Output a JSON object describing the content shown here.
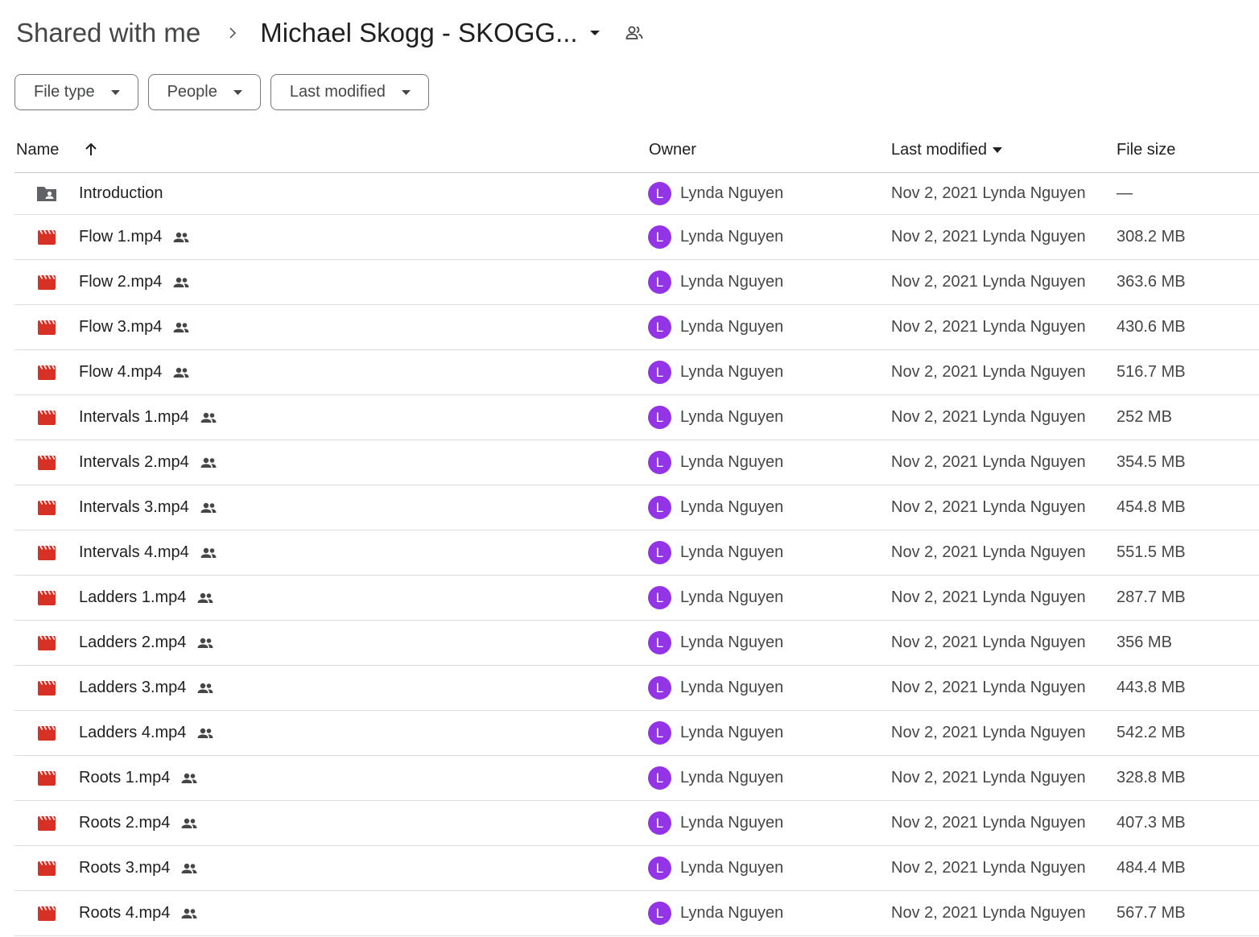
{
  "breadcrumb": {
    "root": "Shared with me",
    "current": "Michael Skogg - SKOGG..."
  },
  "filters": [
    {
      "label": "File type"
    },
    {
      "label": "People"
    },
    {
      "label": "Last modified"
    }
  ],
  "columns": {
    "name": "Name",
    "owner": "Owner",
    "last_modified": "Last modified",
    "file_size": "File size"
  },
  "colors": {
    "avatar": "#9334e6",
    "video_icon": "#d93025",
    "folder_icon": "#5f6368"
  },
  "rows": [
    {
      "type": "folder",
      "icon": "shared-folder-icon",
      "name": "Introduction",
      "shared": false,
      "owner_initial": "L",
      "owner": "Lynda Nguyen",
      "modified": "Nov 2, 2021 Lynda Nguyen",
      "size": "—"
    },
    {
      "type": "video",
      "icon": "video-file-icon",
      "name": "Flow 1.mp4",
      "shared": true,
      "owner_initial": "L",
      "owner": "Lynda Nguyen",
      "modified": "Nov 2, 2021 Lynda Nguyen",
      "size": "308.2 MB"
    },
    {
      "type": "video",
      "icon": "video-file-icon",
      "name": "Flow 2.mp4",
      "shared": true,
      "owner_initial": "L",
      "owner": "Lynda Nguyen",
      "modified": "Nov 2, 2021 Lynda Nguyen",
      "size": "363.6 MB"
    },
    {
      "type": "video",
      "icon": "video-file-icon",
      "name": "Flow 3.mp4",
      "shared": true,
      "owner_initial": "L",
      "owner": "Lynda Nguyen",
      "modified": "Nov 2, 2021 Lynda Nguyen",
      "size": "430.6 MB"
    },
    {
      "type": "video",
      "icon": "video-file-icon",
      "name": "Flow 4.mp4",
      "shared": true,
      "owner_initial": "L",
      "owner": "Lynda Nguyen",
      "modified": "Nov 2, 2021 Lynda Nguyen",
      "size": "516.7 MB"
    },
    {
      "type": "video",
      "icon": "video-file-icon",
      "name": "Intervals 1.mp4",
      "shared": true,
      "owner_initial": "L",
      "owner": "Lynda Nguyen",
      "modified": "Nov 2, 2021 Lynda Nguyen",
      "size": "252 MB"
    },
    {
      "type": "video",
      "icon": "video-file-icon",
      "name": "Intervals 2.mp4",
      "shared": true,
      "owner_initial": "L",
      "owner": "Lynda Nguyen",
      "modified": "Nov 2, 2021 Lynda Nguyen",
      "size": "354.5 MB"
    },
    {
      "type": "video",
      "icon": "video-file-icon",
      "name": "Intervals 3.mp4",
      "shared": true,
      "owner_initial": "L",
      "owner": "Lynda Nguyen",
      "modified": "Nov 2, 2021 Lynda Nguyen",
      "size": "454.8 MB"
    },
    {
      "type": "video",
      "icon": "video-file-icon",
      "name": "Intervals 4.mp4",
      "shared": true,
      "owner_initial": "L",
      "owner": "Lynda Nguyen",
      "modified": "Nov 2, 2021 Lynda Nguyen",
      "size": "551.5 MB"
    },
    {
      "type": "video",
      "icon": "video-file-icon",
      "name": "Ladders 1.mp4",
      "shared": true,
      "owner_initial": "L",
      "owner": "Lynda Nguyen",
      "modified": "Nov 2, 2021 Lynda Nguyen",
      "size": "287.7 MB"
    },
    {
      "type": "video",
      "icon": "video-file-icon",
      "name": "Ladders 2.mp4",
      "shared": true,
      "owner_initial": "L",
      "owner": "Lynda Nguyen",
      "modified": "Nov 2, 2021 Lynda Nguyen",
      "size": "356 MB"
    },
    {
      "type": "video",
      "icon": "video-file-icon",
      "name": "Ladders 3.mp4",
      "shared": true,
      "owner_initial": "L",
      "owner": "Lynda Nguyen",
      "modified": "Nov 2, 2021 Lynda Nguyen",
      "size": "443.8 MB"
    },
    {
      "type": "video",
      "icon": "video-file-icon",
      "name": "Ladders 4.mp4",
      "shared": true,
      "owner_initial": "L",
      "owner": "Lynda Nguyen",
      "modified": "Nov 2, 2021 Lynda Nguyen",
      "size": "542.2 MB"
    },
    {
      "type": "video",
      "icon": "video-file-icon",
      "name": "Roots 1.mp4",
      "shared": true,
      "owner_initial": "L",
      "owner": "Lynda Nguyen",
      "modified": "Nov 2, 2021 Lynda Nguyen",
      "size": "328.8 MB"
    },
    {
      "type": "video",
      "icon": "video-file-icon",
      "name": "Roots 2.mp4",
      "shared": true,
      "owner_initial": "L",
      "owner": "Lynda Nguyen",
      "modified": "Nov 2, 2021 Lynda Nguyen",
      "size": "407.3 MB"
    },
    {
      "type": "video",
      "icon": "video-file-icon",
      "name": "Roots 3.mp4",
      "shared": true,
      "owner_initial": "L",
      "owner": "Lynda Nguyen",
      "modified": "Nov 2, 2021 Lynda Nguyen",
      "size": "484.4 MB"
    },
    {
      "type": "video",
      "icon": "video-file-icon",
      "name": "Roots 4.mp4",
      "shared": true,
      "owner_initial": "L",
      "owner": "Lynda Nguyen",
      "modified": "Nov 2, 2021 Lynda Nguyen",
      "size": "567.7 MB"
    }
  ]
}
